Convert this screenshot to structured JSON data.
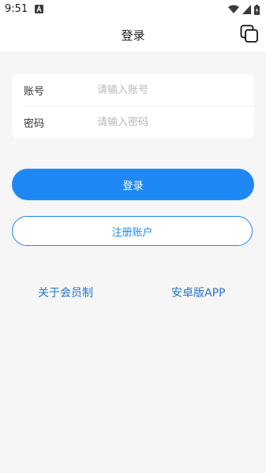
{
  "status_bar": {
    "time": "9:51",
    "icons": [
      "a-notification-icon",
      "wifi-icon",
      "signal-icon",
      "battery-charging-icon"
    ]
  },
  "nav": {
    "title": "登录",
    "right_icon": "copy-icon"
  },
  "form": {
    "account_label": "账号",
    "account_placeholder": "请输入账号",
    "account_value": "",
    "password_label": "密码",
    "password_placeholder": "请输入密码",
    "password_value": ""
  },
  "buttons": {
    "login_label": "登录",
    "register_label": "注册账户"
  },
  "links": {
    "about_membership": "关于会员制",
    "android_app": "安卓版APP"
  },
  "colors": {
    "accent": "#1e88f5",
    "link": "#2676c8",
    "background": "#f6f6f7"
  }
}
